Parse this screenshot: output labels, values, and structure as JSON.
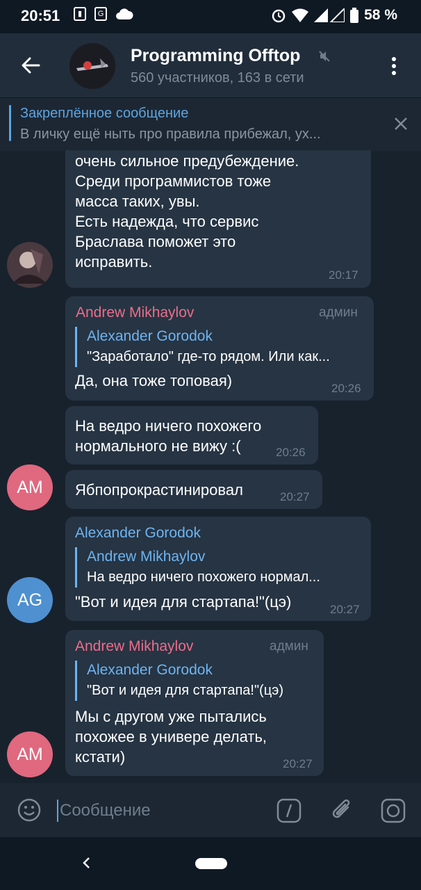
{
  "status": {
    "time": "20:51",
    "battery": "58 %",
    "icons": [
      "sim-icon",
      "translate-icon",
      "cloud-icon",
      "alarm-icon",
      "wifi-icon",
      "signal-icon",
      "battery-icon"
    ]
  },
  "header": {
    "title": "Programming Offtop",
    "subtitle": "560 участников, 163 в сети",
    "icons": [
      "back-arrow-icon",
      "mute-icon",
      "more-vert-icon"
    ]
  },
  "pinned": {
    "title": "Закреплённое сообщение",
    "text": "В личку ещё ныть про правила прибежал, ух...",
    "icon": "close-icon"
  },
  "messages": [
    {
      "text": "В обычных кругах \"я вы сказал\"\nочень сильное предубеждение.\nСреди программистов тоже\nмасса таких, увы.\nЕсть надежда, что сервис\nБраслава поможет это\nисправить.",
      "time": "20:17"
    },
    {
      "sender": "Andrew Mikhaylov",
      "badge": "админ",
      "reply_name": "Alexander Gorodok",
      "reply_text": "\"Заработало\" где-то рядом. Или как...",
      "text": "Да, она тоже топовая)",
      "time": "20:26"
    },
    {
      "text": "На ведро ничего похожего\nнормального не вижу :(",
      "time": "20:26"
    },
    {
      "text": "Ябпопрокрастинировал",
      "time": "20:27",
      "avatar": "AM"
    },
    {
      "sender": "Alexander Gorodok",
      "reply_name": "Andrew Mikhaylov",
      "reply_text": "На ведро ничего похожего нормал...",
      "text": "\"Вот и идея для стартапа!\"(цэ)",
      "time": "20:27",
      "avatar": "AG"
    },
    {
      "sender": "Andrew Mikhaylov",
      "badge": "админ",
      "reply_name": "Alexander Gorodok",
      "reply_text": "\"Вот и идея для стартапа!\"(цэ)",
      "text": "Мы с другом уже пытались\nпохожее в универе делать,\nкстати)",
      "time": "20:27",
      "avatar": "AM"
    }
  ],
  "input": {
    "placeholder": "Сообщение",
    "icons": [
      "emoji-icon",
      "bot-command-icon",
      "attach-icon",
      "camera-icon"
    ]
  },
  "nav": {
    "icons": [
      "nav-back-icon",
      "home-pill"
    ]
  },
  "colors": {
    "background": "#18222d",
    "bubble": "#263443",
    "accent": "#5da5e0",
    "admin_name": "#ee6c8a",
    "user_name": "#6fb4f0"
  }
}
